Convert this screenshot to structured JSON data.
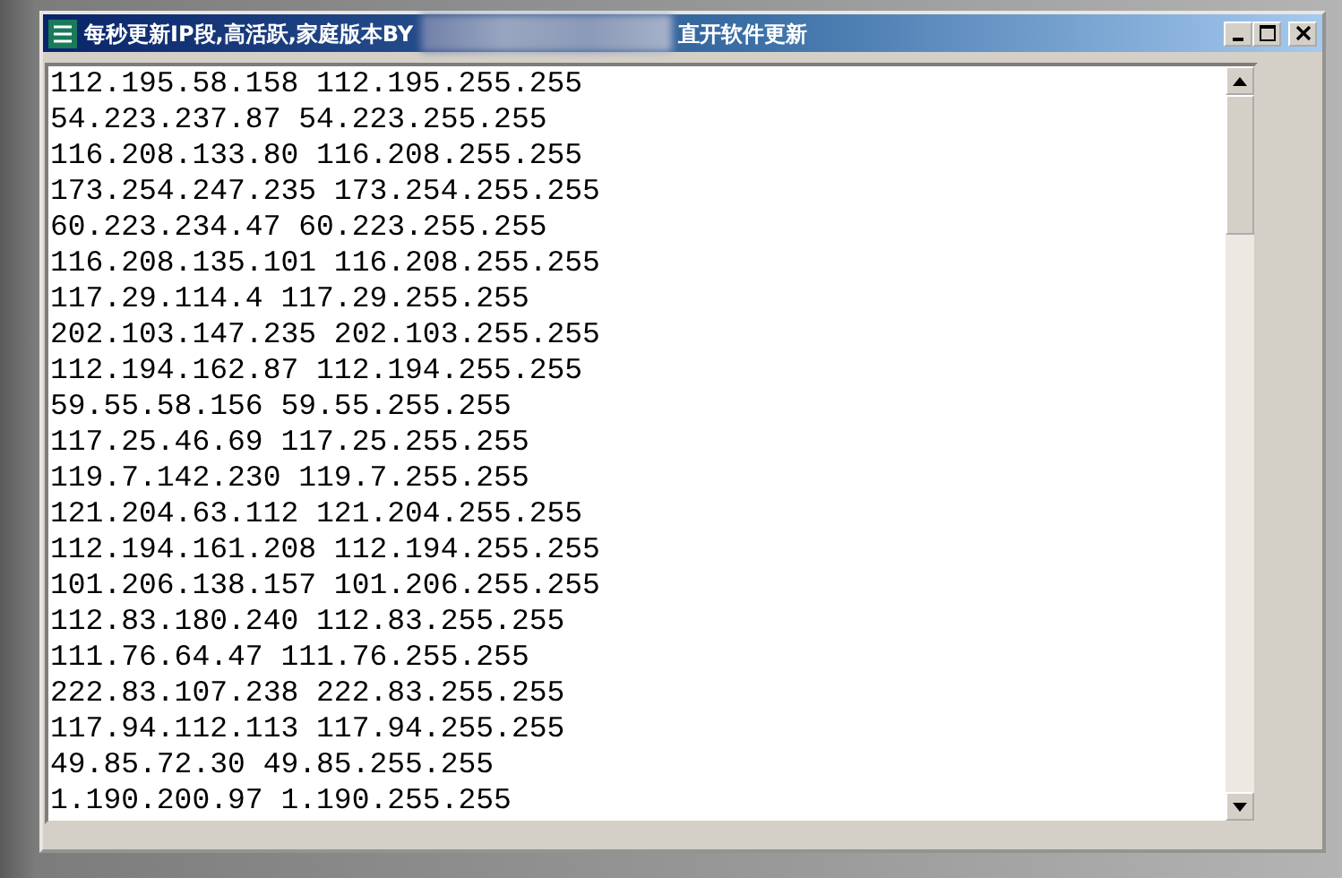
{
  "window": {
    "title_start": "每秒更新IP段,高活跃,家庭版本BY",
    "title_end": "直开软件更新"
  },
  "lines": [
    "112.195.58.158 112.195.255.255",
    "54.223.237.87 54.223.255.255",
    "116.208.133.80 116.208.255.255",
    "173.254.247.235 173.254.255.255",
    "60.223.234.47 60.223.255.255",
    "116.208.135.101 116.208.255.255",
    "117.29.114.4 117.29.255.255",
    "202.103.147.235 202.103.255.255",
    "112.194.162.87 112.194.255.255",
    "59.55.58.156 59.55.255.255",
    "117.25.46.69 117.25.255.255",
    "119.7.142.230 119.7.255.255",
    "121.204.63.112 121.204.255.255",
    "112.194.161.208 112.194.255.255",
    "101.206.138.157 101.206.255.255",
    "112.83.180.240 112.83.255.255",
    "111.76.64.47 111.76.255.255",
    "222.83.107.238 222.83.255.255",
    "117.94.112.113 117.94.255.255",
    "49.85.72.30 49.85.255.255",
    "1.190.200.97 1.190.255.255"
  ]
}
